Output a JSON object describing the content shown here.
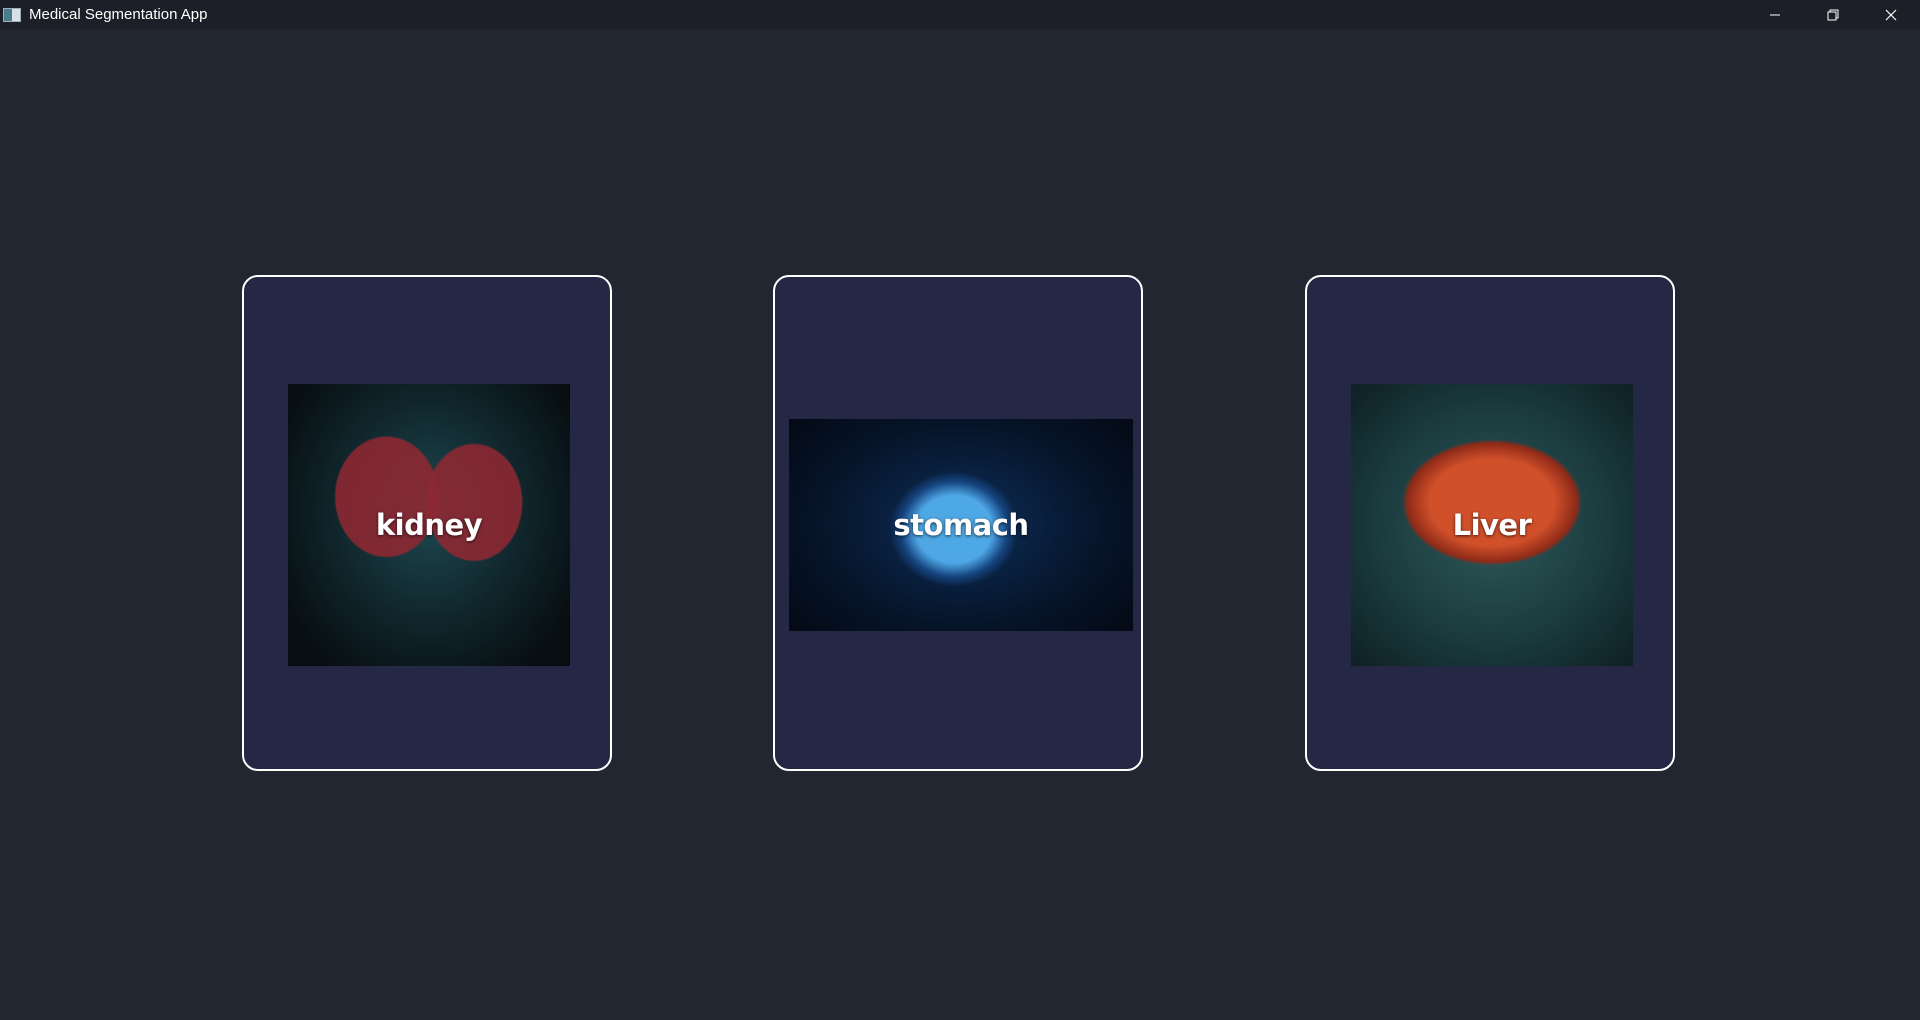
{
  "window": {
    "title": "Medical Segmentation App",
    "controls": [
      "minimize-icon",
      "restore-icon",
      "close-icon"
    ]
  },
  "cards": [
    {
      "label": "kidney",
      "image": "kidney-illustration"
    },
    {
      "label": "stomach",
      "image": "stomach-illustration"
    },
    {
      "label": "Liver",
      "image": "liver-illustration"
    }
  ],
  "colors": {
    "background": "#212630",
    "titlebar": "#1c1f27",
    "card_fill": "#242845",
    "card_border": "#ffffff",
    "label": "#ffffff"
  }
}
